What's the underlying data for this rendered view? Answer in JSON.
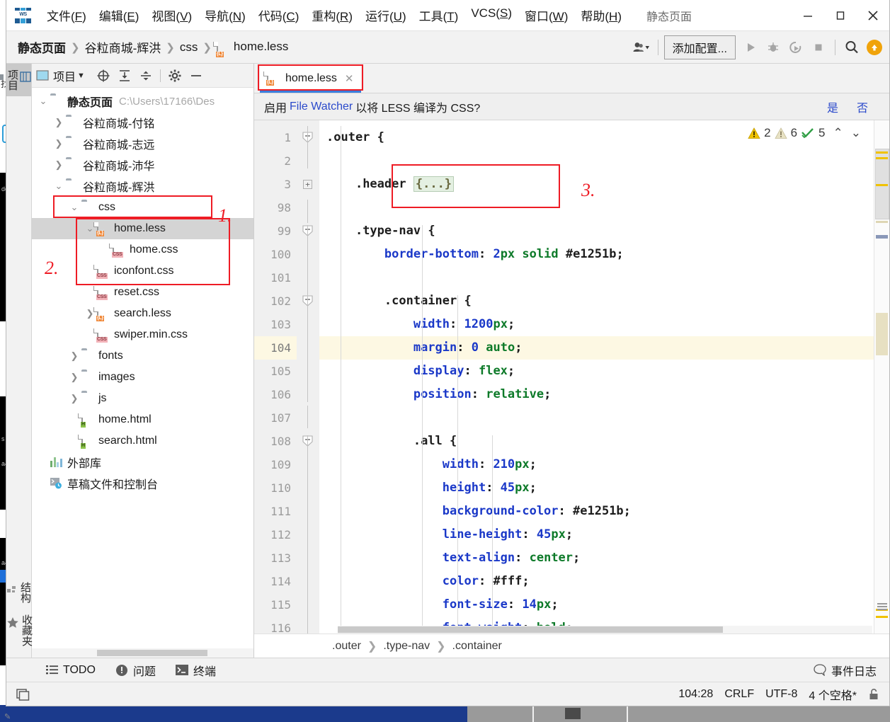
{
  "window": {
    "title": "静态页面",
    "logo_text": "WS",
    "minimize": "−",
    "maximize": "□",
    "close": "✕"
  },
  "menubar": {
    "items": [
      {
        "label": "文件",
        "accel": "F"
      },
      {
        "label": "编辑",
        "accel": "E"
      },
      {
        "label": "视图",
        "accel": "V"
      },
      {
        "label": "导航",
        "accel": "N"
      },
      {
        "label": "代码",
        "accel": "C"
      },
      {
        "label": "重构",
        "accel": "R"
      },
      {
        "label": "运行",
        "accel": "U"
      },
      {
        "label": "工具",
        "accel": "T"
      },
      {
        "label": "VCS",
        "accel": "S"
      },
      {
        "label": "窗口",
        "accel": "W"
      },
      {
        "label": "帮助",
        "accel": "H"
      }
    ]
  },
  "navbar": {
    "breadcrumbs": [
      "静态页面",
      "谷粒商城-辉洪",
      "css",
      "home.less"
    ],
    "file_badge": "{L}",
    "add_config_label": "添加配置...",
    "icons": [
      "user-dropdown-icon",
      "run-icon",
      "debug-icon",
      "run-coverage-icon",
      "stop-icon",
      "search-everywhere-icon",
      "update-icon"
    ]
  },
  "toolstrip": {
    "left_top": "项目",
    "left_bottom": [
      "结构",
      "收藏夹"
    ]
  },
  "project_panel": {
    "header_title": "项目",
    "header_icons": [
      "scroll-from-source-icon",
      "collapse-all-icon",
      "expand-all-icon",
      "settings-icon",
      "hide-icon"
    ],
    "tree": [
      {
        "depth": 0,
        "chev": "down",
        "icon": "folder",
        "label": "静态页面",
        "bold": true,
        "path": "C:\\Users\\17166\\Des",
        "selected": false
      },
      {
        "depth": 1,
        "chev": "right",
        "icon": "folder",
        "label": "谷粒商城-付铭",
        "bold": false,
        "path": "",
        "selected": false
      },
      {
        "depth": 1,
        "chev": "right",
        "icon": "folder",
        "label": "谷粒商城-志远",
        "bold": false,
        "path": "",
        "selected": false
      },
      {
        "depth": 1,
        "chev": "right",
        "icon": "folder",
        "label": "谷粒商城-沛华",
        "bold": false,
        "path": "",
        "selected": false
      },
      {
        "depth": 1,
        "chev": "down",
        "icon": "folder",
        "label": "谷粒商城-辉洪",
        "bold": false,
        "path": "",
        "selected": false
      },
      {
        "depth": 2,
        "chev": "down",
        "icon": "folder",
        "label": "css",
        "bold": false,
        "path": "",
        "selected": false
      },
      {
        "depth": 3,
        "chev": "down",
        "icon": "less",
        "label": "home.less",
        "bold": false,
        "path": "",
        "selected": true
      },
      {
        "depth": 4,
        "chev": "none",
        "icon": "css",
        "label": "home.css",
        "bold": false,
        "path": "",
        "selected": false
      },
      {
        "depth": 3,
        "chev": "none",
        "icon": "css",
        "label": "iconfont.css",
        "bold": false,
        "path": "",
        "selected": false
      },
      {
        "depth": 3,
        "chev": "none",
        "icon": "css",
        "label": "reset.css",
        "bold": false,
        "path": "",
        "selected": false
      },
      {
        "depth": 3,
        "chev": "right",
        "icon": "less",
        "label": "search.less",
        "bold": false,
        "path": "",
        "selected": false
      },
      {
        "depth": 3,
        "chev": "none",
        "icon": "css",
        "label": "swiper.min.css",
        "bold": false,
        "path": "",
        "selected": false
      },
      {
        "depth": 2,
        "chev": "right",
        "icon": "folder",
        "label": "fonts",
        "bold": false,
        "path": "",
        "selected": false
      },
      {
        "depth": 2,
        "chev": "right",
        "icon": "folder",
        "label": "images",
        "bold": false,
        "path": "",
        "selected": false
      },
      {
        "depth": 2,
        "chev": "right",
        "icon": "folder",
        "label": "js",
        "bold": false,
        "path": "",
        "selected": false
      },
      {
        "depth": 2,
        "chev": "none",
        "icon": "html",
        "label": "home.html",
        "bold": false,
        "path": "",
        "selected": false
      },
      {
        "depth": 2,
        "chev": "none",
        "icon": "html",
        "label": "search.html",
        "bold": false,
        "path": "",
        "selected": false
      },
      {
        "depth": 0,
        "chev": "none",
        "icon": "lib",
        "label": "外部库",
        "bold": false,
        "path": "",
        "selected": false
      },
      {
        "depth": 0,
        "chev": "none",
        "icon": "console",
        "label": "草稿文件和控制台",
        "bold": false,
        "path": "",
        "selected": false
      }
    ]
  },
  "annotations": [
    {
      "id": "1",
      "label": "1."
    },
    {
      "id": "2",
      "label": "2."
    },
    {
      "id": "3",
      "label": "3."
    }
  ],
  "editor": {
    "tab": {
      "label": "home.less",
      "badge": "{L}",
      "close": "✕"
    },
    "watcher": {
      "prefix": "启用",
      "link": "File Watcher",
      "suffix": "以将 LESS 编译为 CSS?",
      "yes": "是",
      "no": "否"
    },
    "inspection": {
      "warnings": "2",
      "weak_warnings": "6",
      "ok": "5",
      "up": "⌃",
      "down": "⌄"
    },
    "lines": [
      {
        "num": "1",
        "mark": "",
        "hl": false,
        "fold": "collapse",
        "indent": 0,
        "tokens": [
          {
            "t": ".outer",
            "c": "sel"
          },
          {
            "t": " {",
            "c": "punc"
          }
        ]
      },
      {
        "num": "2",
        "mark": "",
        "hl": false,
        "fold": "",
        "indent": 0,
        "tokens": []
      },
      {
        "num": "3",
        "mark": "",
        "hl": false,
        "fold": "expand",
        "indent": 1,
        "tokens": [
          {
            "t": ".header",
            "c": "sel"
          },
          {
            "t": " ",
            "c": "punc"
          },
          {
            "t": "{...}",
            "c": "fold"
          }
        ]
      },
      {
        "num": "98",
        "mark": "",
        "hl": false,
        "fold": "",
        "indent": 0,
        "tokens": []
      },
      {
        "num": "99",
        "mark": "",
        "hl": false,
        "fold": "collapse",
        "indent": 1,
        "tokens": [
          {
            "t": ".type-nav",
            "c": "sel"
          },
          {
            "t": " {",
            "c": "punc"
          }
        ]
      },
      {
        "num": "100",
        "mark": "red",
        "hl": false,
        "fold": "",
        "indent": 2,
        "tokens": [
          {
            "t": "border-bottom",
            "c": "prop"
          },
          {
            "t": ": ",
            "c": "punc"
          },
          {
            "t": "2",
            "c": "num"
          },
          {
            "t": "px",
            "c": "val"
          },
          {
            "t": " ",
            "c": "punc"
          },
          {
            "t": "solid",
            "c": "val"
          },
          {
            "t": " ",
            "c": "punc"
          },
          {
            "t": "#e1251b",
            "c": "punc"
          },
          {
            "t": ";",
            "c": "punc"
          }
        ]
      },
      {
        "num": "101",
        "mark": "",
        "hl": false,
        "fold": "",
        "indent": 0,
        "tokens": []
      },
      {
        "num": "102",
        "mark": "",
        "hl": false,
        "fold": "collapse",
        "indent": 2,
        "tokens": [
          {
            "t": ".container",
            "c": "sel"
          },
          {
            "t": " {",
            "c": "punc"
          }
        ]
      },
      {
        "num": "103",
        "mark": "",
        "hl": false,
        "fold": "",
        "indent": 3,
        "tokens": [
          {
            "t": "width",
            "c": "prop"
          },
          {
            "t": ": ",
            "c": "punc"
          },
          {
            "t": "1200",
            "c": "num"
          },
          {
            "t": "px",
            "c": "val"
          },
          {
            "t": ";",
            "c": "punc"
          }
        ]
      },
      {
        "num": "104",
        "mark": "",
        "hl": true,
        "fold": "",
        "indent": 3,
        "tokens": [
          {
            "t": "margin",
            "c": "prop"
          },
          {
            "t": ": ",
            "c": "punc"
          },
          {
            "t": "0",
            "c": "num"
          },
          {
            "t": " ",
            "c": "punc"
          },
          {
            "t": "auto",
            "c": "val"
          },
          {
            "t": ";",
            "c": "punc"
          }
        ]
      },
      {
        "num": "105",
        "mark": "",
        "hl": false,
        "fold": "",
        "indent": 3,
        "tokens": [
          {
            "t": "display",
            "c": "prop"
          },
          {
            "t": ": ",
            "c": "punc"
          },
          {
            "t": "flex",
            "c": "val"
          },
          {
            "t": ";",
            "c": "punc"
          }
        ]
      },
      {
        "num": "106",
        "mark": "",
        "hl": false,
        "fold": "",
        "indent": 3,
        "tokens": [
          {
            "t": "position",
            "c": "prop"
          },
          {
            "t": ": ",
            "c": "punc"
          },
          {
            "t": "relative",
            "c": "val"
          },
          {
            "t": ";",
            "c": "punc"
          }
        ]
      },
      {
        "num": "107",
        "mark": "",
        "hl": false,
        "fold": "",
        "indent": 0,
        "tokens": []
      },
      {
        "num": "108",
        "mark": "",
        "hl": false,
        "fold": "collapse",
        "indent": 3,
        "tokens": [
          {
            "t": ".all",
            "c": "sel"
          },
          {
            "t": " {",
            "c": "punc"
          }
        ]
      },
      {
        "num": "109",
        "mark": "",
        "hl": false,
        "fold": "",
        "indent": 4,
        "tokens": [
          {
            "t": "width",
            "c": "prop"
          },
          {
            "t": ": ",
            "c": "punc"
          },
          {
            "t": "210",
            "c": "num"
          },
          {
            "t": "px",
            "c": "val"
          },
          {
            "t": ";",
            "c": "punc"
          }
        ]
      },
      {
        "num": "110",
        "mark": "",
        "hl": false,
        "fold": "",
        "indent": 4,
        "tokens": [
          {
            "t": "height",
            "c": "prop"
          },
          {
            "t": ": ",
            "c": "punc"
          },
          {
            "t": "45",
            "c": "num"
          },
          {
            "t": "px",
            "c": "val"
          },
          {
            "t": ";",
            "c": "punc"
          }
        ]
      },
      {
        "num": "111",
        "mark": "red",
        "hl": false,
        "fold": "",
        "indent": 4,
        "tokens": [
          {
            "t": "background-color",
            "c": "prop"
          },
          {
            "t": ": ",
            "c": "punc"
          },
          {
            "t": "#e1251b",
            "c": "punc"
          },
          {
            "t": ";",
            "c": "punc"
          }
        ]
      },
      {
        "num": "112",
        "mark": "",
        "hl": false,
        "fold": "",
        "indent": 4,
        "tokens": [
          {
            "t": "line-height",
            "c": "prop"
          },
          {
            "t": ": ",
            "c": "punc"
          },
          {
            "t": "45",
            "c": "num"
          },
          {
            "t": "px",
            "c": "val"
          },
          {
            "t": ";",
            "c": "punc"
          }
        ]
      },
      {
        "num": "113",
        "mark": "",
        "hl": false,
        "fold": "",
        "indent": 4,
        "tokens": [
          {
            "t": "text-align",
            "c": "prop"
          },
          {
            "t": ": ",
            "c": "punc"
          },
          {
            "t": "center",
            "c": "val"
          },
          {
            "t": ";",
            "c": "punc"
          }
        ]
      },
      {
        "num": "114",
        "mark": "white",
        "hl": false,
        "fold": "",
        "indent": 4,
        "tokens": [
          {
            "t": "color",
            "c": "prop"
          },
          {
            "t": ": ",
            "c": "punc"
          },
          {
            "t": "#fff",
            "c": "punc"
          },
          {
            "t": ";",
            "c": "punc"
          }
        ]
      },
      {
        "num": "115",
        "mark": "",
        "hl": false,
        "fold": "",
        "indent": 4,
        "tokens": [
          {
            "t": "font-size",
            "c": "prop"
          },
          {
            "t": ": ",
            "c": "punc"
          },
          {
            "t": "14",
            "c": "num"
          },
          {
            "t": "px",
            "c": "val"
          },
          {
            "t": ";",
            "c": "punc"
          }
        ]
      },
      {
        "num": "116",
        "mark": "",
        "hl": false,
        "fold": "",
        "indent": 4,
        "tokens": [
          {
            "t": "font-weight",
            "c": "prop"
          },
          {
            "t": ": ",
            "c": "punc"
          },
          {
            "t": "bold",
            "c": "val"
          },
          {
            "t": ";",
            "c": "punc"
          }
        ]
      }
    ],
    "code_breadcrumb": [
      ".outer",
      ".type-nav",
      ".container"
    ]
  },
  "bottombar": {
    "items": [
      {
        "label": "TODO",
        "icon": "todo-list-icon"
      },
      {
        "label": "问题",
        "icon": "problems-icon"
      },
      {
        "label": "终端",
        "icon": "terminal-icon"
      }
    ],
    "event_log": "事件日志",
    "event_log_icon": "balloon-icon"
  },
  "statusbar": {
    "caret": "104:28",
    "line_sep": "CRLF",
    "encoding": "UTF-8",
    "indent": "4 个空格*",
    "lock_icon": "unlocked-icon",
    "layout_icon": "layout-icon"
  },
  "colors": {
    "accent_red": "#e1251b",
    "annotation_red": "#ee1c25",
    "link_blue": "#2b4acb",
    "selection_gray": "#d4d4d4",
    "tab_underline": "#3b7ddd",
    "highlight_row": "#fdf8e3"
  }
}
